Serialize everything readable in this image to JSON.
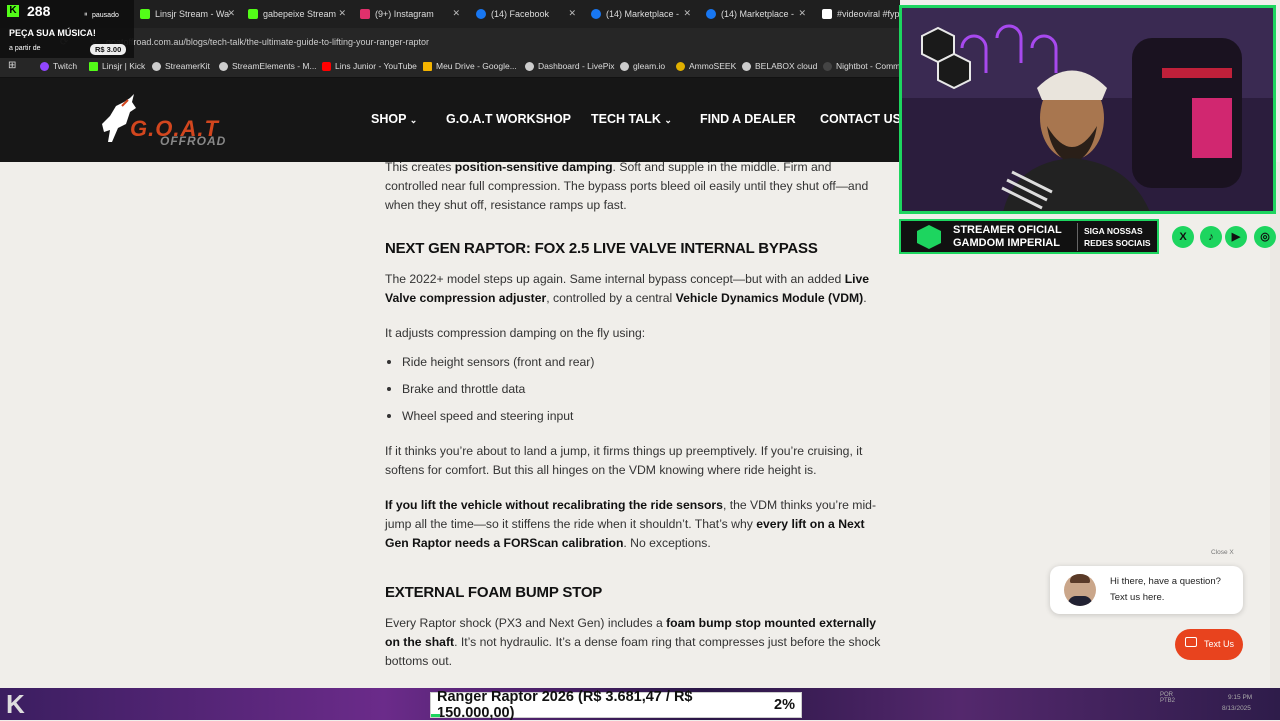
{
  "browser": {
    "tabs": [
      {
        "label": "Linsjr Stream - Wa",
        "color": "#53fc18"
      },
      {
        "label": "gabepeixe Stream",
        "color": "#53fc18"
      },
      {
        "label": "(9+) Instagram",
        "color": "#e1306c"
      },
      {
        "label": "(14) Facebook",
        "color": "#1877f2"
      },
      {
        "label": "(14) Marketplace -",
        "color": "#1877f2"
      },
      {
        "label": "(14) Marketplace -",
        "color": "#1877f2"
      },
      {
        "label": "#videoviral #fyp #",
        "color": "#ffffff"
      }
    ],
    "url": "goatoffroad.com.au/blogs/tech-talk/the-ultimate-guide-to-lifting-your-ranger-raptor",
    "bookmarks": [
      {
        "label": "Twitch",
        "color": "#9146ff"
      },
      {
        "label": "Linsjr | Kick",
        "color": "#53fc18"
      },
      {
        "label": "StreamerKit",
        "color": "#cccccc"
      },
      {
        "label": "StreamElements - M...",
        "color": "#cccccc"
      },
      {
        "label": "Lins Junior - YouTube",
        "color": "#ff0000"
      },
      {
        "label": "Meu Drive - Google...",
        "color": "#f4b400"
      },
      {
        "label": "Dashboard - LivePix",
        "color": "#cccccc"
      },
      {
        "label": "gleam.io",
        "color": "#cccccc"
      },
      {
        "label": "AmmoSEEK",
        "color": "#e0b000"
      },
      {
        "label": "BELABOX cloud",
        "color": "#cccccc"
      },
      {
        "label": "Nightbot - Comm",
        "color": "#444444"
      }
    ]
  },
  "overlay": {
    "viewers": "288",
    "status": "pausado",
    "music_title": "PEÇA SUA MÚSICA!",
    "from_label": "a partir de",
    "price": "R$ 3.00"
  },
  "site": {
    "logo_text": "G.O.A.T",
    "logo_sub": "OFFROAD",
    "nav": [
      {
        "label": "SHOP",
        "dropdown": true
      },
      {
        "label": "G.O.A.T WORKSHOP",
        "dropdown": false
      },
      {
        "label": "TECH TALK",
        "dropdown": true
      },
      {
        "label": "FIND A DEALER",
        "dropdown": false
      },
      {
        "label": "CONTACT US",
        "dropdown": false
      }
    ]
  },
  "article": {
    "p1_a": "This creates ",
    "p1_b": "position-sensitive damping",
    "p1_c": ". Soft and supple in the middle. Firm and controlled near full compression. The bypass ports bleed oil easily until they shut off—and when they shut off, resistance ramps up fast.",
    "h2_1": "NEXT GEN RAPTOR: FOX 2.5 LIVE VALVE INTERNAL BYPASS",
    "p2_a": "The 2022+ model steps up again. Same internal bypass concept—but with an added ",
    "p2_b": "Live Valve compression adjuster",
    "p2_c": ", controlled by a central ",
    "p2_d": "Vehicle Dynamics Module (VDM)",
    "p2_e": ".",
    "p3": "It adjusts compression damping on the fly using:",
    "bullets": [
      "Ride height sensors (front and rear)",
      "Brake and throttle data",
      "Wheel speed and steering input"
    ],
    "p4": "If it thinks you’re about to land a jump, it firms things up preemptively. If you’re cruising, it softens for comfort. But this all hinges on the VDM knowing where ride height is.",
    "p5_a": "If you lift the vehicle without recalibrating the ride sensors",
    "p5_b": ", the VDM thinks you’re mid-jump all the time—so it stiffens the ride when it shouldn’t. That’s why ",
    "p5_c": "every lift on a Next Gen Raptor needs a FORScan calibration",
    "p5_d": ". No exceptions.",
    "h2_2": "EXTERNAL FOAM BUMP STOP",
    "p6_a": "Every Raptor shock (PX3 and Next Gen) includes a ",
    "p6_b": "foam bump stop mounted externally on the shaft",
    "p6_c": ". It’s not hydraulic. It’s a dense foam ring that compresses just before the shock bottoms out."
  },
  "stream": {
    "banner_line1": "STREAMER OFICIAL",
    "banner_line2": "GAMDOM IMPERIAL",
    "banner_line3": "SIGA NOSSAS",
    "banner_line4": "REDES SOCIAIS",
    "socials": [
      "X",
      "♪",
      "▶",
      "◎"
    ],
    "goal_text": "Ranger Raptor 2026 (R$ 3.681,47 / R$ 150.000,00)",
    "goal_percent": "2%",
    "goal_progress": 0.0245
  },
  "chat": {
    "close_label": "Close X",
    "line1": "Hi there, have a question?",
    "line2": "Text us here.",
    "button_label": "Text Us"
  },
  "taskbar": {
    "time": "9:15 PM",
    "date": "8/13/2025",
    "lang": "POR PTB2"
  }
}
